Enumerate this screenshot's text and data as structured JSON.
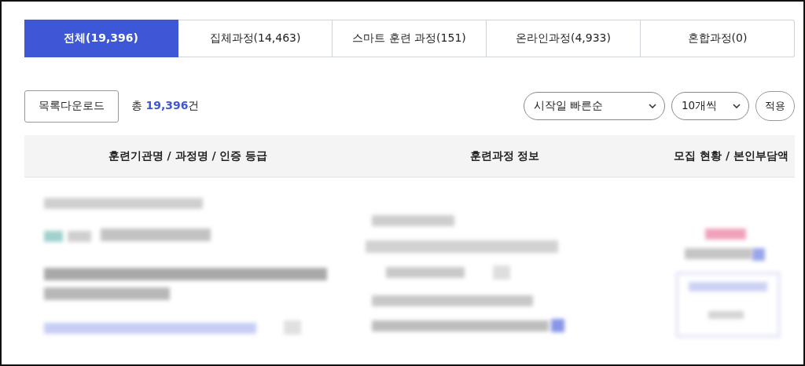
{
  "tabs": [
    {
      "label": "전체(19,396)",
      "selected": true
    },
    {
      "label": "집체과정(14,463)",
      "selected": false
    },
    {
      "label": "스마트 훈련 과정(151)",
      "selected": false
    },
    {
      "label": "온라인과정(4,933)",
      "selected": false
    },
    {
      "label": "혼합과정(0)",
      "selected": false
    }
  ],
  "toolbar": {
    "download_button": "목록다운로드",
    "total": "총 **19,396**건",
    "sort_select": "시작일 빠른순",
    "page_size_select": "10개씩",
    "apply_button": "적용"
  },
  "table": {
    "columns": [
      "훈련기관명 / 과정명 / 인증 등급",
      "훈련과정 정보",
      "모집 현황 / 본인부담액"
    ]
  }
}
